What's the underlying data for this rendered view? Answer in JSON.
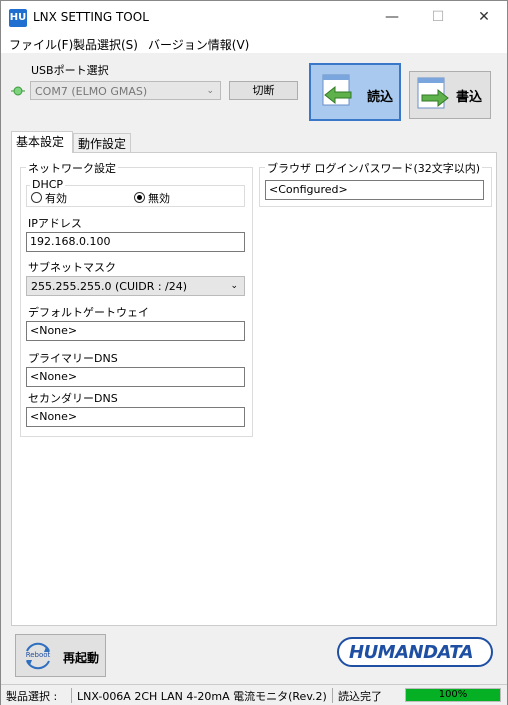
{
  "window": {
    "app_icon_text": "HU",
    "title": "LNX SETTING TOOL",
    "minimize": "—",
    "maximize": "☐",
    "close": "✕"
  },
  "menu": [
    "ファイル(F)",
    "製品選択(S)",
    "バージョン情報(V)"
  ],
  "usb": {
    "label": "USBポート選択",
    "port": "COM7 (ELMO GMAS)",
    "disconnect_button": "切断"
  },
  "actions": {
    "read_label": "読込",
    "write_label": "書込",
    "reboot_label": "再起動",
    "reboot_icon_text": "Reboot"
  },
  "tabs": [
    "基本設定",
    "動作設定"
  ],
  "network": {
    "group_title": "ネットワーク設定",
    "dhcp_label": "DHCP",
    "dhcp_options": [
      "有効",
      "無効"
    ],
    "dhcp_selected": "無効",
    "ip_label": "IPアドレス",
    "ip_value": "192.168.0.100",
    "subnet_label": "サブネットマスク",
    "subnet_value": "255.255.255.0 (CUIDR : /24)",
    "gateway_label": "デフォルトゲートウェイ",
    "gateway_value": "<None>",
    "dns1_label": "プライマリーDNS",
    "dns1_value": "<None>",
    "dns2_label": "セカンダリーDNS",
    "dns2_value": "<None>"
  },
  "browser_password": {
    "group_title": "ブラウザ ログインパスワード(32文字以内)",
    "value": "<Configured>"
  },
  "logo": "HUMANDATA",
  "status": {
    "product_label": "製品選択 :",
    "product_value": "LNX-006A 2CH LAN 4-20mA 電流モニタ(Rev.2)",
    "state": "読込完了",
    "progress_text": "100%",
    "progress_value": 1.0
  },
  "colors": {
    "read_button_bg": "#a9c9ee",
    "read_button_border": "#3b77c9",
    "progress_fill": "#06b025",
    "logo_blue": "#1f4fa3"
  }
}
